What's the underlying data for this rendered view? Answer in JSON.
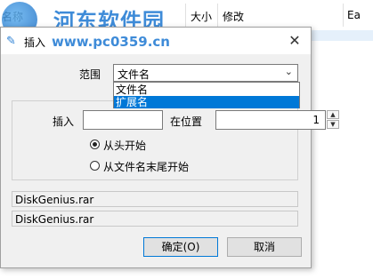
{
  "background": {
    "columns": [
      "名称",
      "大小",
      "修改"
    ],
    "right_text": "Ea"
  },
  "watermark": {
    "title": "河东软件园",
    "url": "www.pc0359.cn"
  },
  "dialog": {
    "title": "插入",
    "close_glyph": "✕",
    "scope_label": "范围",
    "scope_selected": "文件名",
    "scope_options": [
      "文件名",
      "扩展名"
    ],
    "insert_label": "插入",
    "insert_value": "",
    "position_label": "在位置",
    "position_value": "1",
    "radio_from_start": "从头开始",
    "radio_from_end": "从文件名末尾开始",
    "preview_before": "DiskGenius.rar",
    "preview_after": "DiskGenius.rar",
    "ok_label": "确定(O)",
    "cancel_label": "取消"
  },
  "colors": {
    "accent": "#0078d7",
    "watermark": "#2a7fd4"
  }
}
